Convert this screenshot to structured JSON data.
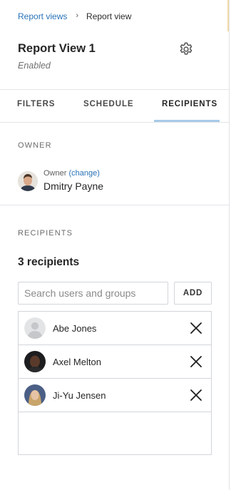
{
  "breadcrumb": {
    "parent": "Report views",
    "separator": "›",
    "current": "Report view"
  },
  "header": {
    "title": "Report View 1",
    "status": "Enabled",
    "settings_icon": "gear-icon"
  },
  "tabs": [
    {
      "label": "FILTERS",
      "active": false
    },
    {
      "label": "SCHEDULE",
      "active": false
    },
    {
      "label": "RECIPIENTS",
      "active": true
    }
  ],
  "owner": {
    "section_label": "OWNER",
    "caption": "Owner",
    "change_link": "(change)",
    "name": "Dmitry Payne"
  },
  "recipients": {
    "section_label": "RECIPIENTS",
    "count_label": "3 recipients",
    "search_placeholder": "Search users and groups",
    "search_value": "",
    "add_label": "ADD",
    "items": [
      {
        "name": "Abe Jones",
        "avatar": "default-avatar-icon"
      },
      {
        "name": "Axel Melton",
        "avatar": "photo"
      },
      {
        "name": "Ji-Yu Jensen",
        "avatar": "photo"
      }
    ]
  },
  "colors": {
    "link": "#2a73b8",
    "tab_underline": "#a8cbe8",
    "border": "#d2d5d9"
  }
}
